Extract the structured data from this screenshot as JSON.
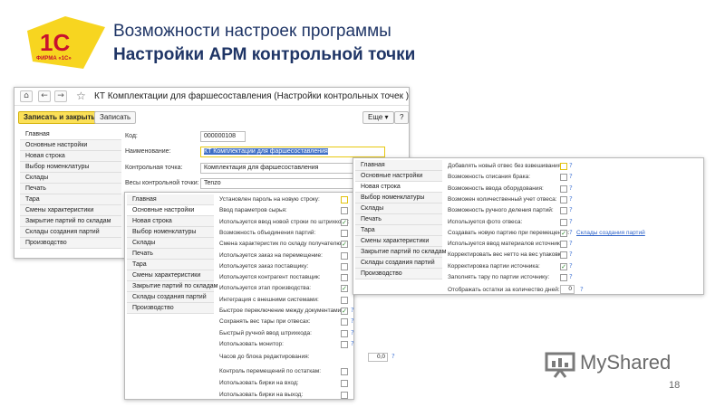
{
  "slide": {
    "title": "Возможности настроек программы",
    "subtitle": "Настройки АРМ контрольной точки",
    "logo_text": "1С",
    "logo_caption": "ФИРМА «1С»",
    "page_number": "18",
    "brand": "MyShared"
  },
  "window_main": {
    "title": "КТ Комплектации для фаршесоставления (Настройки контрольных точек )",
    "nav_home": "⌂",
    "nav_back": "←",
    "nav_forward": "→",
    "star": "☆",
    "toolbar": {
      "save_close": "Записать и закрыть",
      "save": "Записать",
      "more": "Еще ▾",
      "help": "?"
    },
    "sidebar": [
      "Главная",
      "Основные настройки",
      "Новая строка",
      "Выбор номенклатуры",
      "Склады",
      "Печать",
      "Тара",
      "Смены характеристики",
      "Закрытие партий по складам",
      "Склады создания партий",
      "Производство"
    ],
    "fields": {
      "code_label": "Код:",
      "code_value": "000000108",
      "name_label": "Наименование:",
      "name_value": "КТ Комплектации для фаршесоставления",
      "point_label": "Контрольная точка:",
      "point_value": "Комплектация для фаршесоставления",
      "scales_label": "Весы контрольной точки:",
      "scales_value": "Tenzo"
    }
  },
  "window_mid": {
    "sidebar": [
      "Главная",
      "Основные настройки",
      "Новая строка",
      "Выбор номенклатуры",
      "Склады",
      "Печать",
      "Тара",
      "Смены характеристики",
      "Закрытие партий по складам",
      "Склады создания партий",
      "Производство"
    ],
    "settings": [
      {
        "label": "Установлен пароль на новую строку:",
        "checked": false,
        "highlight": true,
        "help": false
      },
      {
        "label": "Ввод параметров сырья:",
        "checked": false,
        "highlight": false,
        "help": false
      },
      {
        "label": "Используется ввод новой строки по штрихкоду:",
        "checked": true,
        "highlight": false,
        "help": false
      },
      {
        "label": "Возможность объединения партий:",
        "checked": false,
        "highlight": false,
        "help": false
      },
      {
        "label": "Смена характеристик по складу получателю:",
        "checked": true,
        "highlight": false,
        "help": false
      },
      {
        "label": "Используется заказ на перемещение:",
        "checked": false,
        "highlight": false,
        "help": false
      },
      {
        "label": "Используется заказ поставщику:",
        "checked": false,
        "highlight": false,
        "help": false
      },
      {
        "label": "Используется контрагент поставщик:",
        "checked": false,
        "highlight": false,
        "help": false
      },
      {
        "label": "Используется этап производства:",
        "checked": true,
        "highlight": false,
        "help": false
      },
      {
        "label": "Интеграция с внешними системами:",
        "checked": false,
        "highlight": false,
        "help": false
      },
      {
        "label": "Быстрое переключение между документами:",
        "checked": true,
        "highlight": false,
        "help": true
      },
      {
        "label": "Сохранять вес тары при отвесах:",
        "checked": false,
        "highlight": false,
        "help": true
      },
      {
        "label": "Быстрый ручной ввод штрихкода:",
        "checked": false,
        "highlight": false,
        "help": true
      },
      {
        "label": "Использовать монитор:",
        "checked": false,
        "highlight": false,
        "help": true
      }
    ],
    "block_label": "Часов до блока редактирования:",
    "block_value": "0,0",
    "bottom_settings": [
      {
        "label": "Контроль перемещений по остаткам:",
        "checked": false
      },
      {
        "label": "Использовать бирки на вход:",
        "checked": false
      },
      {
        "label": "Использовать бирки на выход:",
        "checked": false
      }
    ],
    "help_sign": "?"
  },
  "window_right": {
    "sidebar": [
      "Главная",
      "Основные настройки",
      "Новая строка",
      "Выбор номенклатуры",
      "Склады",
      "Печать",
      "Тара",
      "Смены характеристики",
      "Закрытие партий по складам",
      "Склады создания партий",
      "Производство"
    ],
    "settings": [
      {
        "label": "Добавлять новый отвес без взвешивания:",
        "checked": false,
        "highlight": true
      },
      {
        "label": "Возможность списания брака:",
        "checked": false,
        "highlight": false
      },
      {
        "label": "Возможность ввода оборудования:",
        "checked": false,
        "highlight": false
      },
      {
        "label": "Возможен количественный учет отвеса:",
        "checked": false,
        "highlight": false
      },
      {
        "label": "Возможность ручного деления партий:",
        "checked": false,
        "highlight": false
      },
      {
        "label": "Используется фото отвеса:",
        "checked": false,
        "highlight": false
      },
      {
        "label": "Создавать новую партию при перемещении:",
        "checked": true,
        "highlight": false
      },
      {
        "label": "Используется ввод материалов источников:",
        "checked": false,
        "highlight": false
      },
      {
        "label": "Корректировать вес нетто на вес упаковки:",
        "checked": false,
        "highlight": false
      },
      {
        "label": "Корректировка партии источника:",
        "checked": true,
        "highlight": false
      },
      {
        "label": "Заполнять тару по партии источнику:",
        "checked": false,
        "highlight": false
      }
    ],
    "link_text": "Склады создания партий",
    "remains_label": "Отображать остатки за количество дней:",
    "remains_value": "0",
    "help_sign": "?"
  }
}
